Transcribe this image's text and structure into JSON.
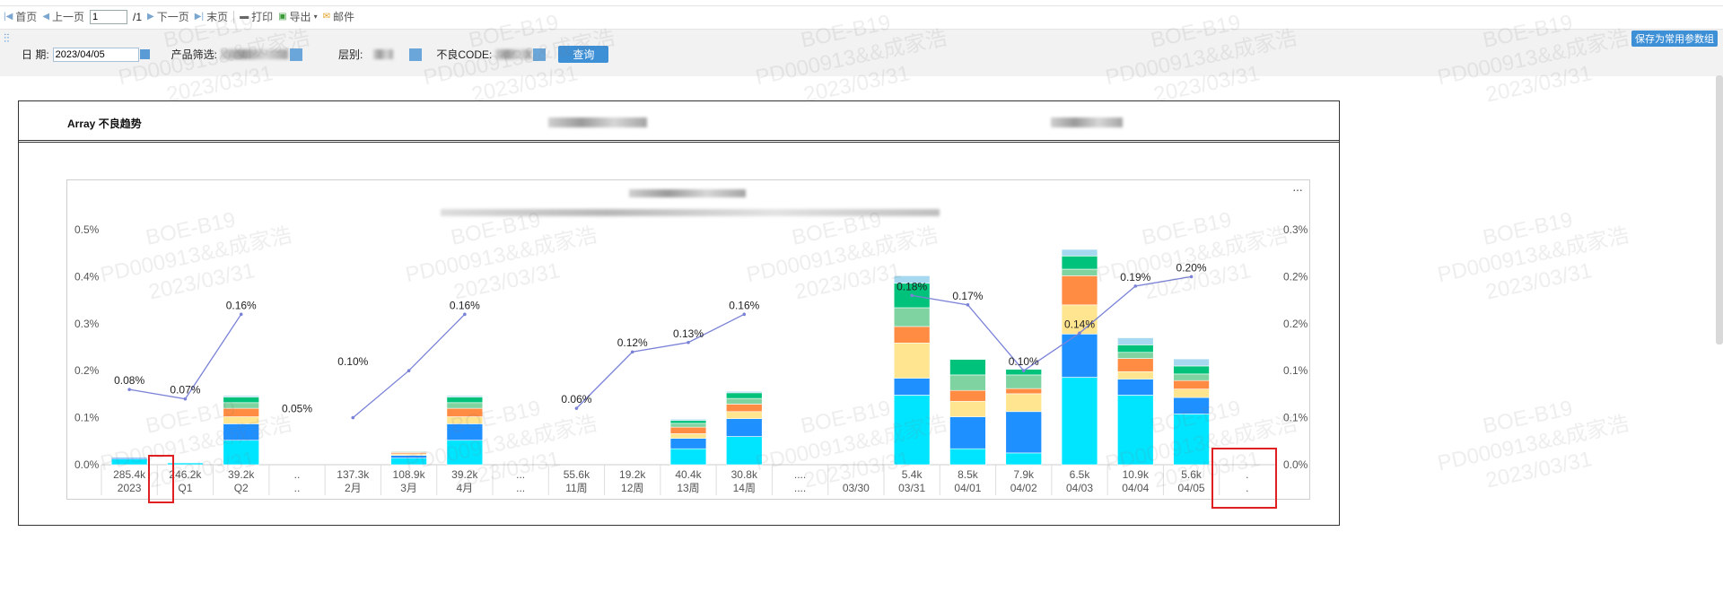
{
  "toolbar": {
    "first_page": "首页",
    "prev_page": "上一页",
    "page_input": "1",
    "page_total": "/1",
    "next_page": "下一页",
    "last_page": "末页",
    "print": "打印",
    "export": "导出",
    "email": "邮件"
  },
  "filters": {
    "date_label": "日  期:",
    "date_value": "2023/04/05",
    "product_label": "产品筛选:",
    "level_label": "层别:",
    "defect_label": "不良CODE:",
    "query_button": "查询",
    "save_button": "保存为常用参数组"
  },
  "report": {
    "title": "Array 不良趋势"
  },
  "watermark": {
    "line1": "BOE-B19",
    "line2": "PD000913&&成家浩",
    "line3": "2023/03/31"
  },
  "colors": {
    "c1": "#00e5ff",
    "c2": "#1e90ff",
    "c3": "#ffe58f",
    "c4": "#ff8c42",
    "c5": "#7ed3a0",
    "c6": "#00c27a",
    "c7": "#a6d8ef",
    "line": "#7a82d8"
  },
  "chart_data": {
    "type": "bar",
    "y_left_ticks": [
      "0.0%",
      "0.1%",
      "0.2%",
      "0.3%",
      "0.4%",
      "0.5%"
    ],
    "y_right_ticks": [
      "0.0%",
      "0.1%",
      "0.1%",
      "0.2%",
      "0.2%",
      "0.3%"
    ],
    "categories": [
      {
        "count": "285.4k",
        "label": "2023"
      },
      {
        "count": "246.2k",
        "label": "Q1"
      },
      {
        "count": "39.2k",
        "label": "Q2"
      },
      {
        "count": "..",
        "label": ".."
      },
      {
        "count": "137.3k",
        "label": "2月"
      },
      {
        "count": "108.9k",
        "label": "3月"
      },
      {
        "count": "39.2k",
        "label": "4月"
      },
      {
        "count": "...",
        "label": "..."
      },
      {
        "count": "55.6k",
        "label": "11周"
      },
      {
        "count": "19.2k",
        "label": "12周"
      },
      {
        "count": "40.4k",
        "label": "13周"
      },
      {
        "count": "30.8k",
        "label": "14周"
      },
      {
        "count": "....",
        "label": "...."
      },
      {
        "count": "",
        "label": "03/30"
      },
      {
        "count": "5.4k",
        "label": "03/31"
      },
      {
        "count": "8.5k",
        "label": "04/01"
      },
      {
        "count": "7.9k",
        "label": "04/02"
      },
      {
        "count": "6.5k",
        "label": "04/03"
      },
      {
        "count": "10.9k",
        "label": "04/04"
      },
      {
        "count": "5.6k",
        "label": "04/05"
      },
      {
        "count": ".",
        "label": "."
      }
    ],
    "stacks": [
      [
        0.012,
        0.003,
        0.001,
        0.001,
        0.001,
        0.001,
        0.001
      ],
      [
        0.004,
        0.001,
        0,
        0,
        0,
        0,
        0
      ],
      [
        0.052,
        0.035,
        0.015,
        0.018,
        0.012,
        0.012,
        0.003
      ],
      [
        0,
        0,
        0,
        0,
        0,
        0,
        0
      ],
      [
        0,
        0,
        0,
        0,
        0,
        0,
        0
      ],
      [
        0.014,
        0.006,
        0.003,
        0.003,
        0.002,
        0.001,
        0.001
      ],
      [
        0.052,
        0.035,
        0.015,
        0.018,
        0.012,
        0.012,
        0.003
      ],
      [
        0,
        0,
        0,
        0,
        0,
        0,
        0
      ],
      [
        0,
        0,
        0,
        0,
        0,
        0,
        0
      ],
      [
        0,
        0,
        0,
        0,
        0,
        0,
        0
      ],
      [
        0.034,
        0.022,
        0.01,
        0.014,
        0.008,
        0.006,
        0.003
      ],
      [
        0.06,
        0.038,
        0.015,
        0.016,
        0.012,
        0.012,
        0.003
      ],
      [
        0,
        0,
        0,
        0,
        0,
        0,
        0
      ],
      [
        0,
        0,
        0,
        0,
        0,
        0,
        0
      ],
      [
        0.148,
        0.036,
        0.075,
        0.035,
        0.04,
        0.052,
        0.016
      ],
      [
        0.034,
        0.068,
        0.033,
        0.023,
        0.033,
        0.033,
        0
      ],
      [
        0.025,
        0.088,
        0.038,
        0.011,
        0.029,
        0.012,
        0
      ],
      [
        0.186,
        0.092,
        0.062,
        0.062,
        0.014,
        0.028,
        0.014
      ],
      [
        0.148,
        0.034,
        0.016,
        0.028,
        0.013,
        0.016,
        0.015
      ],
      [
        0.108,
        0.035,
        0.018,
        0.018,
        0.014,
        0.017,
        0.015
      ],
      [
        0,
        0,
        0,
        0,
        0,
        0,
        0
      ]
    ],
    "series": [
      {
        "segments": [
          {
            "pts": [
              [
                0,
                0.08
              ],
              [
                1,
                0.07
              ],
              [
                2,
                0.16
              ]
            ]
          },
          {
            "pts": [
              [
                4,
                0.05
              ],
              [
                5,
                0.1
              ],
              [
                6,
                0.16
              ]
            ]
          },
          {
            "pts": [
              [
                8,
                0.06
              ],
              [
                9,
                0.12
              ],
              [
                10,
                0.13
              ],
              [
                11,
                0.16
              ]
            ]
          },
          {
            "pts": [
              [
                14,
                0.18
              ],
              [
                15,
                0.17
              ],
              [
                16,
                0.1
              ],
              [
                17,
                0.14
              ],
              [
                18,
                0.19
              ],
              [
                19,
                0.2
              ]
            ]
          }
        ]
      }
    ],
    "line_labels": [
      {
        "text": "0.08%",
        "i": 0,
        "v": 0.08
      },
      {
        "text": "0.07%",
        "i": 1,
        "v": 0.07
      },
      {
        "text": "0.16%",
        "i": 2,
        "v": 0.16
      },
      {
        "text": "0.05%",
        "i": 3,
        "v": 0.05
      },
      {
        "text": "0.10%",
        "i": 4,
        "v": 0.1
      },
      {
        "text": "0.16%",
        "i": 6,
        "v": 0.16
      },
      {
        "text": "0.06%",
        "i": 8,
        "v": 0.06
      },
      {
        "text": "0.12%",
        "i": 9,
        "v": 0.12
      },
      {
        "text": "0.13%",
        "i": 10,
        "v": 0.13
      },
      {
        "text": "0.16%",
        "i": 11,
        "v": 0.16
      },
      {
        "text": "0.18%",
        "i": 14,
        "v": 0.18
      },
      {
        "text": "0.17%",
        "i": 15,
        "v": 0.17
      },
      {
        "text": "0.10%",
        "i": 16,
        "v": 0.1
      },
      {
        "text": "0.14%",
        "i": 17,
        "v": 0.14
      },
      {
        "text": "0.19%",
        "i": 18,
        "v": 0.19
      },
      {
        "text": "0.20%",
        "i": 19,
        "v": 0.2
      }
    ],
    "ylim_left": [
      0,
      0.5
    ],
    "ylim_right": [
      0,
      0.25
    ]
  }
}
